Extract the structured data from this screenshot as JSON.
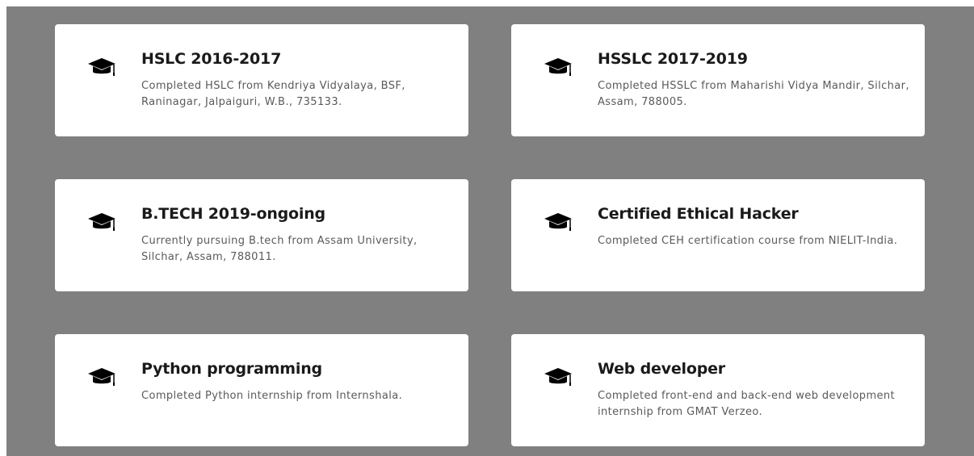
{
  "cards": [
    {
      "icon": "graduation-cap-icon",
      "title": "HSLC 2016-2017",
      "description": "Completed HSLC from Kendriya Vidyalaya, BSF, Raninagar, Jalpaiguri, W.B., 735133."
    },
    {
      "icon": "graduation-cap-icon",
      "title": "HSSLC 2017-2019",
      "description": "Completed HSSLC from Maharishi Vidya Mandir, Silchar, Assam, 788005."
    },
    {
      "icon": "graduation-cap-icon",
      "title": "B.TECH 2019-ongoing",
      "description": "Currently pursuing B.tech from Assam University, Silchar, Assam, 788011."
    },
    {
      "icon": "graduation-cap-icon",
      "title": "Certified Ethical Hacker",
      "description": "Completed CEH certification course from NIELIT-India."
    },
    {
      "icon": "graduation-cap-icon",
      "title": "Python programming",
      "description": "Completed Python internship from Internshala."
    },
    {
      "icon": "graduation-cap-icon",
      "title": "Web developer",
      "description": "Completed front-end and back-end web development internship from GMAT Verzeo."
    }
  ],
  "colors": {
    "background": "#808080",
    "card": "#ffffff",
    "title": "#1a1a1a",
    "description": "#5a5a5a"
  }
}
